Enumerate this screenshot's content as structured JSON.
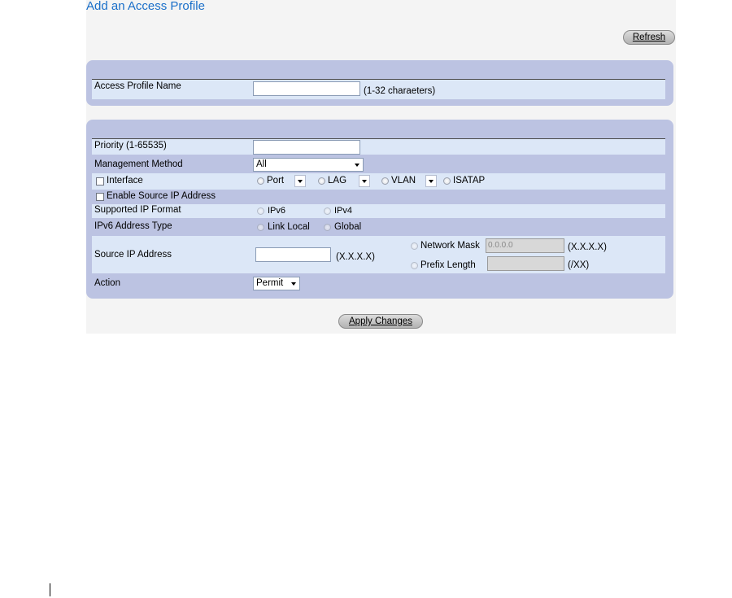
{
  "page": {
    "title": "Add an Access Profile",
    "refresh_label": "Refresh",
    "apply_label": "Apply Changes"
  },
  "profile": {
    "name_label": "Access Profile Name",
    "name_value": "",
    "name_hint": "(1-32 charaeters)"
  },
  "rule": {
    "priority_label": "Priority (1-65535)",
    "priority_value": "",
    "method_label": "Management Method",
    "method_value": "All",
    "interface_label": "Interface",
    "interface_options": {
      "port": "Port",
      "lag": "LAG",
      "vlan": "VLAN",
      "isatap": "ISATAP"
    },
    "enable_src_ip_label": "Enable Source IP Address",
    "ip_format_label": "Supported IP Format",
    "ip_format_options": {
      "ipv6": "IPv6",
      "ipv4": "IPv4"
    },
    "ipv6_type_label": "IPv6 Address Type",
    "ipv6_type_options": {
      "link_local": "Link Local",
      "global": "Global"
    },
    "src_ip_label": "Source IP Address",
    "src_ip_value": "",
    "src_ip_hint": "(X.X.X.X)",
    "network_mask_label": "Network Mask",
    "network_mask_value": "0.0.0.0",
    "network_mask_hint": "(X.X.X.X)",
    "prefix_length_label": "Prefix Length",
    "prefix_length_value": "",
    "prefix_length_hint": "(/XX)",
    "action_label": "Action",
    "action_value": "Permit"
  }
}
